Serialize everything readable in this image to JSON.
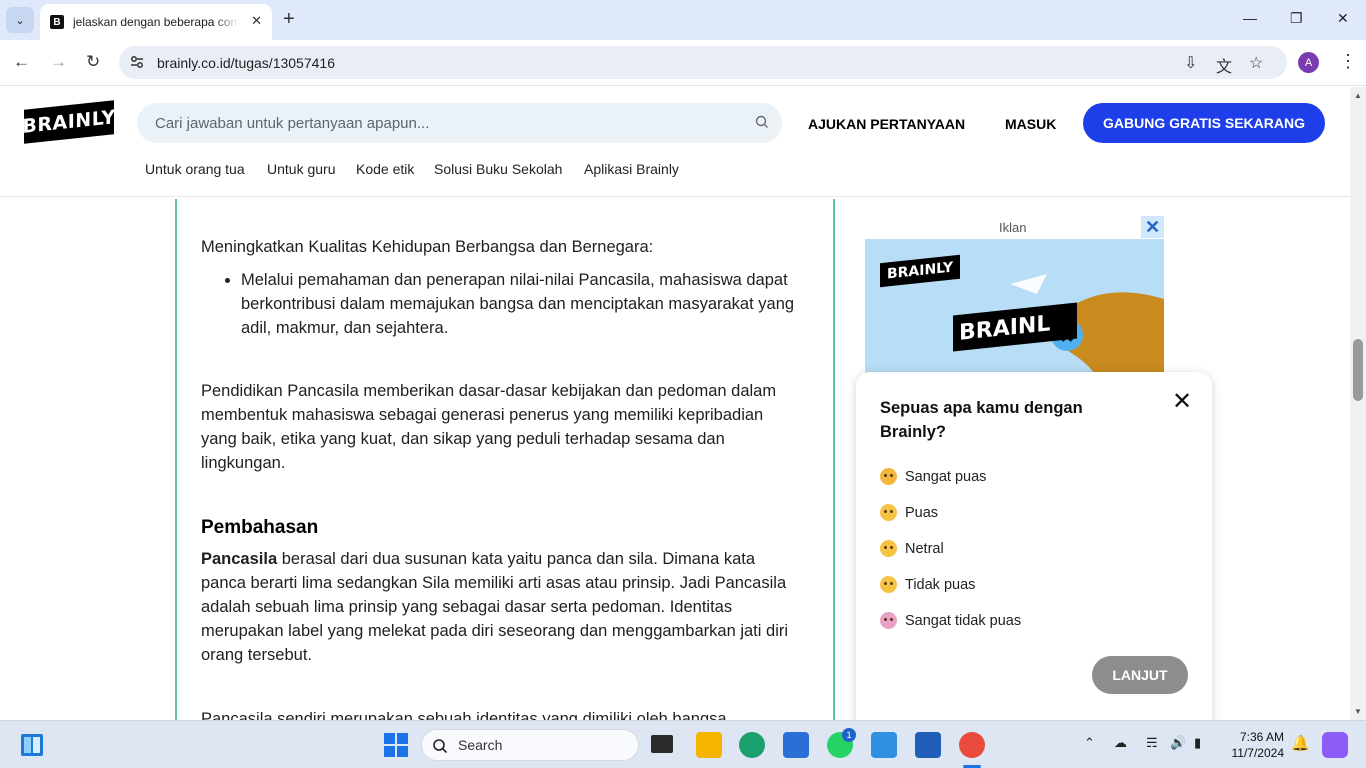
{
  "browser": {
    "tab_title": "jelaskan dengan beberapa cont",
    "tab_favicon": "B",
    "url": "brainly.co.id/tugas/13057416",
    "profile_initial": "A"
  },
  "site": {
    "logo": "BRAINLY",
    "search_placeholder": "Cari jawaban untuk pertanyaan apapun...",
    "ask_label": "AJUKAN PERTANYAAN",
    "login_label": "MASUK",
    "join_label": "GABUNG GRATIS SEKARANG",
    "subnav": [
      "Untuk orang tua",
      "Untuk guru",
      "Kode etik",
      "Solusi Buku Sekolah",
      "Aplikasi Brainly"
    ]
  },
  "article": {
    "p1": "Meningkatkan Kualitas Kehidupan Berbangsa dan Bernegara:",
    "bullet1": "Melalui pemahaman dan penerapan nilai-nilai Pancasila, mahasiswa dapat berkontribusi dalam memajukan bangsa dan menciptakan masyarakat yang adil, makmur, dan sejahtera.",
    "p2": "Pendidikan Pancasila memberikan dasar-dasar kebijakan dan pedoman dalam membentuk mahasiswa sebagai generasi penerus yang memiliki kepribadian yang baik, etika yang kuat, dan sikap yang peduli terhadap sesama dan lingkungan.",
    "heading": "Pembahasan",
    "p3_bold": "Pancasila",
    "p3_rest": " berasal dari dua susunan kata yaitu panca dan sila. Dimana kata panca berarti lima sedangkan Sila memiliki arti asas atau prinsip. Jadi Pancasila adalah sebuah lima prinsip yang sebagai dasar serta pedoman. Identitas merupakan label yang melekat pada diri seseorang dan menggambarkan jati diri orang tersebut.",
    "p4": "Pancasila sendiri merupakan sebuah identitas yang dimiliki oleh bangsa"
  },
  "ad": {
    "label": "Iklan",
    "logo_small": "BRAINLY",
    "logo_large": "BRAINL"
  },
  "survey": {
    "title": "Sepuas apa kamu dengan Brainly?",
    "options": [
      "Sangat puas",
      "Puas",
      "Netral",
      "Tidak puas",
      "Sangat tidak puas"
    ],
    "next_label": "LANJUT"
  },
  "taskbar": {
    "search_label": "Search",
    "whatsapp_badge": "1",
    "time": "7:36 AM",
    "date": "11/7/2024"
  }
}
